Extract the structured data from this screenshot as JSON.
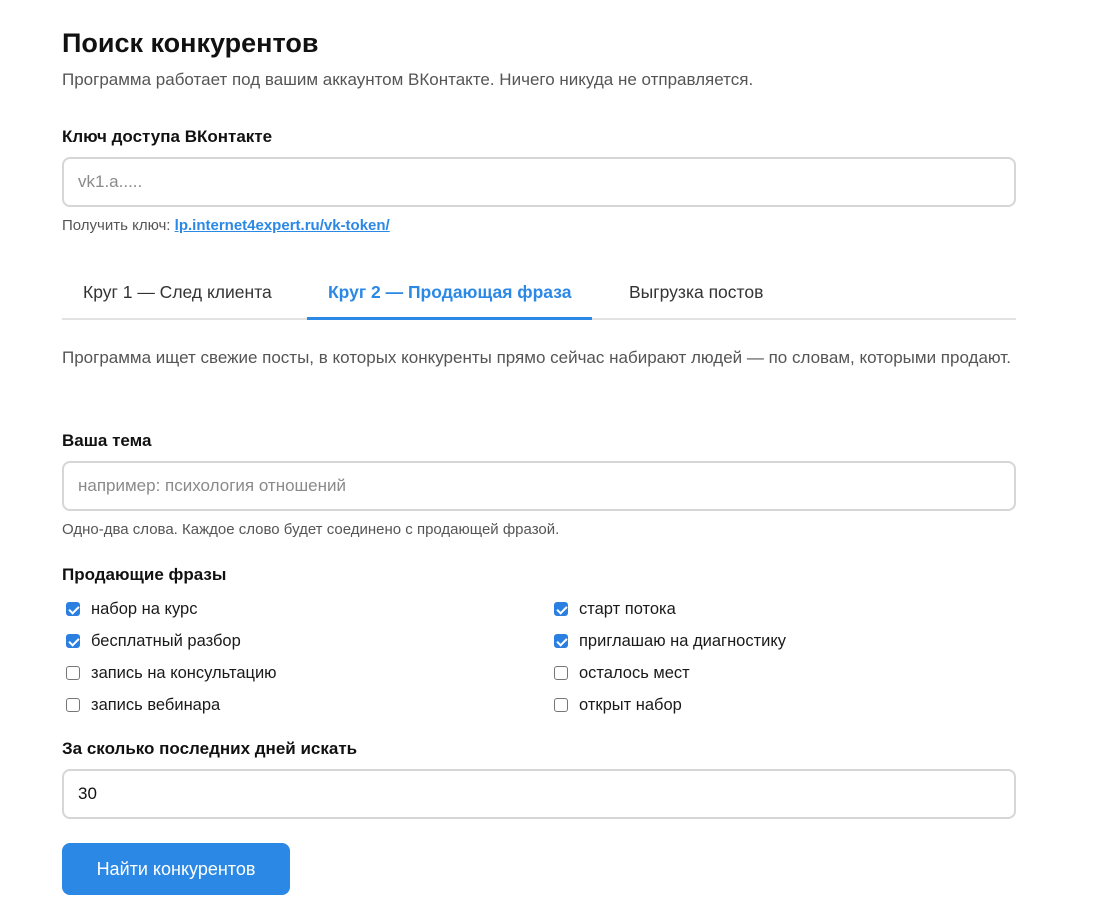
{
  "header": {
    "title": "Поиск конкурентов",
    "subtitle": "Программа работает под вашим аккаунтом ВКонтакте. Ничего никуда не отправляется."
  },
  "token": {
    "label": "Ключ доступа ВКонтакте",
    "placeholder": "vk1.a.....",
    "value": "",
    "hint_prefix": "Получить ключ: ",
    "hint_link": "lp.internet4expert.ru/vk-token/"
  },
  "tabs": [
    {
      "label": "Круг 1 — След клиента",
      "active": false
    },
    {
      "label": "Круг 2 — Продающая фраза",
      "active": true
    },
    {
      "label": "Выгрузка постов",
      "active": false
    }
  ],
  "description": "Программа ищет свежие посты, в которых конкуренты прямо сейчас набирают людей — по словам, которыми продают.",
  "topic": {
    "label": "Ваша тема",
    "placeholder": "например: психология отношений",
    "value": "",
    "hint": "Одно-два слова. Каждое слово будет соединено с продающей фразой."
  },
  "phrases": {
    "label": "Продающие фразы",
    "items": [
      {
        "label": "набор на курс",
        "checked": true
      },
      {
        "label": "старт потока",
        "checked": true
      },
      {
        "label": "бесплатный разбор",
        "checked": true
      },
      {
        "label": "приглашаю на диагностику",
        "checked": true
      },
      {
        "label": "запись на консультацию",
        "checked": false
      },
      {
        "label": "осталось мест",
        "checked": false
      },
      {
        "label": "запись вебинара",
        "checked": false
      },
      {
        "label": "открыт набор",
        "checked": false
      }
    ]
  },
  "days": {
    "label": "За сколько последних дней искать",
    "value": "30"
  },
  "submit_label": "Найти конкурентов",
  "colors": {
    "accent": "#2b88e5",
    "border": "#d6d6d6"
  }
}
